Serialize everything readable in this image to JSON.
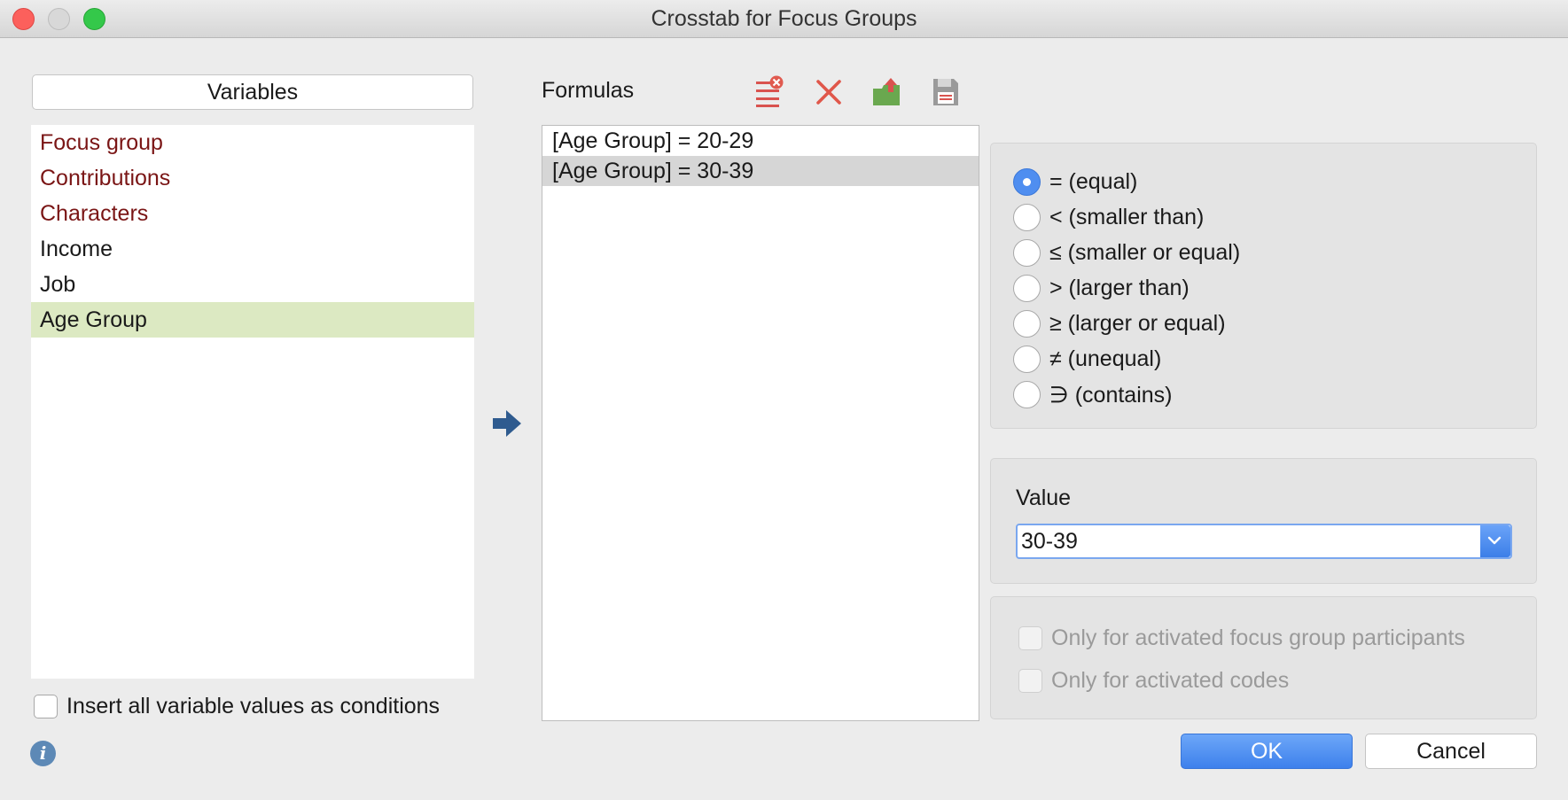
{
  "window": {
    "title": "Crosstab for Focus Groups"
  },
  "variables": {
    "header": "Variables",
    "items": [
      "Focus group",
      "Contributions",
      "Characters",
      "Income",
      "Job",
      "Age Group"
    ],
    "selected": "Age Group",
    "insert_all_label": "Insert all variable values as conditions"
  },
  "formulas": {
    "label": "Formulas",
    "items": [
      "[Age Group] = 20-29",
      "[Age Group] = 30-39"
    ],
    "selected": "[Age Group] = 30-39",
    "tools": [
      "clear-list-icon",
      "delete-icon",
      "export-icon",
      "save-icon"
    ]
  },
  "operators": {
    "items": [
      "= (equal)",
      "< (smaller than)",
      "≤ (smaller or equal)",
      "> (larger than)",
      "≥ (larger or equal)",
      "≠ (unequal)",
      "∋ (contains)"
    ],
    "selected": "= (equal)"
  },
  "value": {
    "label": "Value",
    "current": "30-39"
  },
  "options": {
    "participants_label": "Only for activated focus group participants",
    "codes_label": "Only for activated codes"
  },
  "buttons": {
    "ok": "OK",
    "cancel": "Cancel"
  },
  "colors": {
    "accent": "#4f8ef0",
    "document_variable": "#7a1515",
    "selection": "#dce9c2"
  }
}
